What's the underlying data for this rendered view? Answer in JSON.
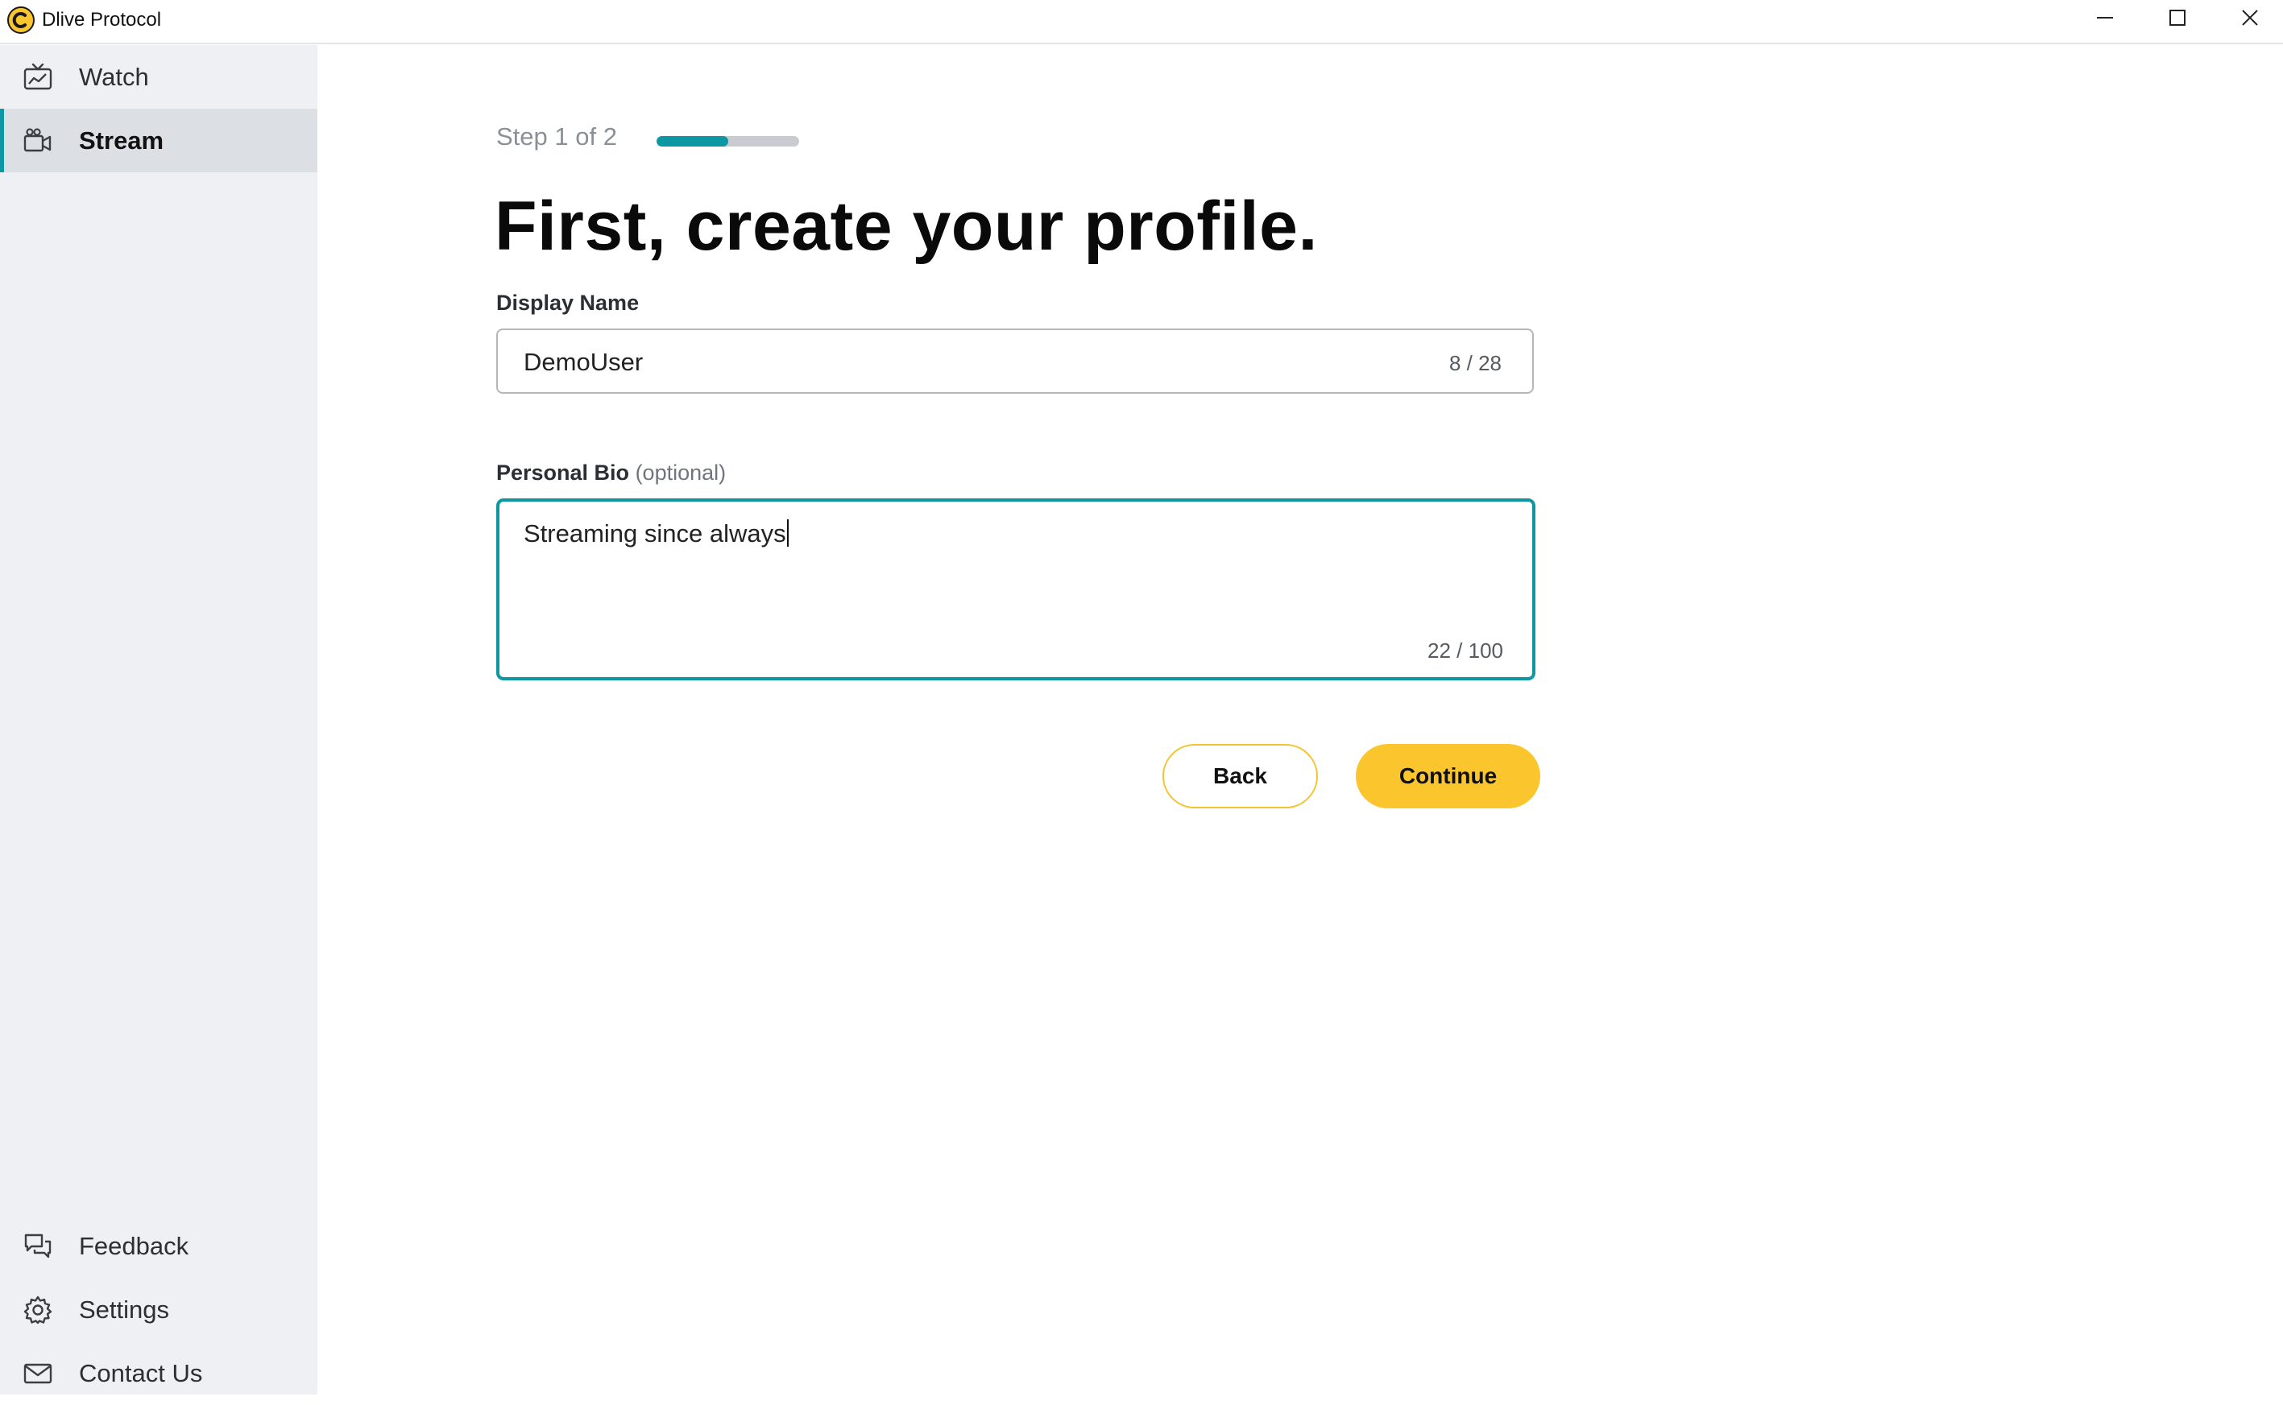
{
  "window": {
    "title": "Dlive Protocol",
    "controls": [
      "minimize",
      "maximize",
      "close"
    ]
  },
  "colors": {
    "accent": "#0d97a3",
    "brand_yellow": "#fbc52d",
    "sidebar_bg": "#eef0f3",
    "sidebar_active_bg": "#dcdfe3"
  },
  "sidebar": {
    "top_items": [
      {
        "label": "Watch",
        "icon": "tv-chart-icon",
        "active": false
      },
      {
        "label": "Stream",
        "icon": "video-camera-icon",
        "active": true
      }
    ],
    "bottom_items": [
      {
        "label": "Feedback",
        "icon": "chat-bubbles-icon"
      },
      {
        "label": "Settings",
        "icon": "gear-icon"
      },
      {
        "label": "Contact Us",
        "icon": "envelope-icon"
      }
    ]
  },
  "main": {
    "step_text": "Step 1 of 2",
    "progress_fraction": 0.5,
    "heading": "First, create your profile.",
    "display_name": {
      "label": "Display Name",
      "value": "DemoUser",
      "counter": "8 / 28"
    },
    "bio": {
      "label": "Personal Bio",
      "label_optional": "(optional)",
      "value": "Streaming since always",
      "counter": "22 / 100"
    },
    "buttons": {
      "back": "Back",
      "continue": "Continue"
    }
  }
}
